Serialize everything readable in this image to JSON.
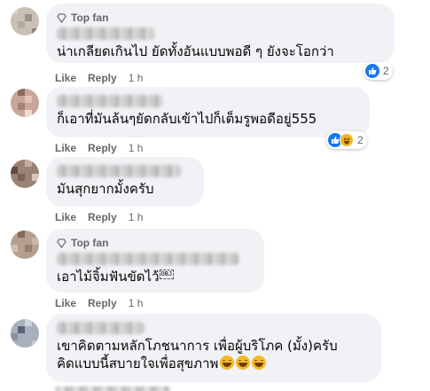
{
  "labels": {
    "top_fan": "Top fan",
    "like": "Like",
    "reply": "Reply"
  },
  "comments": [
    {
      "top_fan": true,
      "text": "น่าเกลียดเกินไป ยัดทั้งอันแบบพอดี ๆ ยังจะโอกว่า",
      "time": "1 h",
      "reaction_count": "2",
      "reactions": [
        "like"
      ]
    },
    {
      "top_fan": false,
      "text": "ก็เอาที่มันล้นๆยัดกลับเข้าไปก็เต็มรูพอดีอยู่555",
      "time": "1 h",
      "reaction_count": "2",
      "reactions": [
        "like",
        "haha"
      ]
    },
    {
      "top_fan": false,
      "text": "มันสุกยากมั้งครับ",
      "time": "1 h"
    },
    {
      "top_fan": true,
      "text": "เอาไม้จิ้มฟันขัดไว้",
      "object_box": "OBJ",
      "time": "1 h"
    },
    {
      "top_fan": false,
      "lines": [
        "เขาคิดตามหลักโภชนาการ เพื่อผู้บริโภค (มั้ง)ครับ",
        "คิดแบบนี้สบายใจเพื่อสุขภาพ"
      ],
      "emoji_count": 3
    }
  ],
  "colors": {
    "bubble": "#f0f2f5",
    "secondary_text": "#65676b",
    "like_blue": "#1877f2",
    "haha_yellow": "#f7b125"
  }
}
